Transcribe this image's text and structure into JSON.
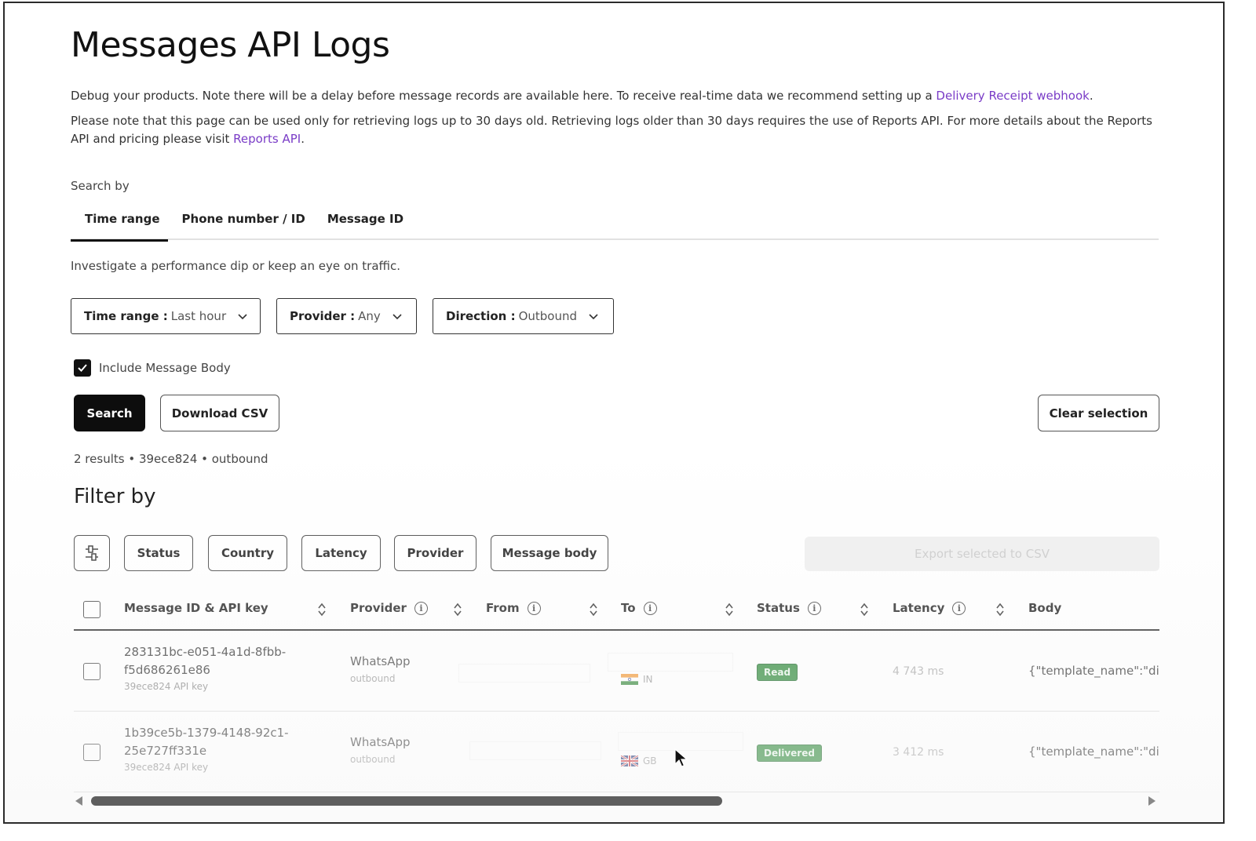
{
  "page": {
    "title": "Messages API Logs",
    "desc1_text": "Debug your products. Note there will be a delay before message records are available here. To receive real-time data we recommend setting up a ",
    "desc1_link": "Delivery Receipt webhook",
    "desc1_end": ".",
    "desc2_text": "Please note that this page can be used only for retrieving logs up to 30 days old. Retrieving logs older than 30 days requires the use of Reports API. For more details about the Reports API and pricing please visit ",
    "desc2_link": "Reports API",
    "desc2_end": "."
  },
  "search": {
    "label": "Search by",
    "tabs": [
      "Time range",
      "Phone number / ID",
      "Message ID"
    ],
    "active_tab": "Time range",
    "hint": "Investigate a performance dip or keep an eye on traffic."
  },
  "dropdowns": [
    {
      "key": "Time range :",
      "value": "Last hour"
    },
    {
      "key": "Provider :",
      "value": "Any"
    },
    {
      "key": "Direction :",
      "value": "Outbound"
    }
  ],
  "include_body": {
    "label": "Include Message Body",
    "checked": true
  },
  "buttons": {
    "search": "Search",
    "download_csv": "Download CSV",
    "clear_selection": "Clear selection"
  },
  "results_summary": "2 results • 39ece824 • outbound",
  "filter": {
    "title": "Filter by",
    "chips": [
      "Status",
      "Country",
      "Latency",
      "Provider",
      "Message body"
    ],
    "export_label": "Export selected to CSV"
  },
  "table": {
    "columns": [
      "Message ID & API key",
      "Provider",
      "From",
      "To",
      "Status",
      "Latency",
      "Body"
    ],
    "rows": [
      {
        "id_line1": "283131bc-e051-4a1d-8fbb-",
        "id_line2": "f5d686261e86",
        "api_key": "39ece824 API key",
        "provider": "WhatsApp",
        "direction": "outbound",
        "to_country": "IN",
        "status": "Read",
        "latency": "4 743 ms",
        "body": "{\"template_name\":\"di"
      },
      {
        "id_line1": "1b39ce5b-1379-4148-92c1-",
        "id_line2": "25e727ff331e",
        "api_key": "39ece824 API key",
        "provider": "WhatsApp",
        "direction": "outbound",
        "to_country": "GB",
        "status": "Delivered",
        "latency": "3 412 ms",
        "body": "{\"template_name\":\"di"
      }
    ]
  },
  "colors": {
    "accent_link": "#7a3cc7",
    "status_green": "#2f8a3a",
    "primary_button": "#0d0d0d"
  },
  "icons": [
    "chevron-down-icon",
    "check-icon",
    "filter-sliders-icon",
    "info-icon",
    "sort-icon",
    "india-flag-icon",
    "uk-flag-icon",
    "cursor-icon"
  ]
}
